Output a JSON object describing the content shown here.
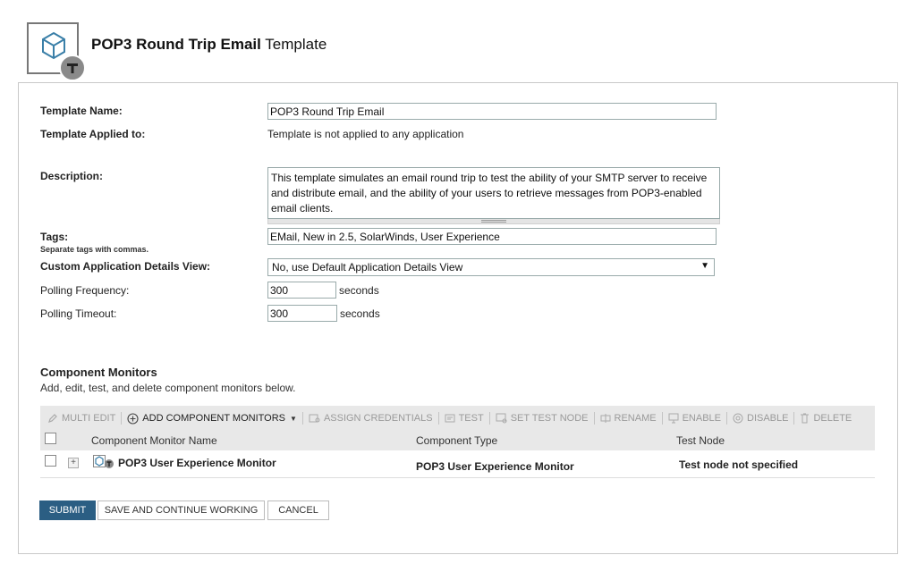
{
  "header": {
    "title_bold": "POP3 Round Trip Email",
    "title_rest": "Template",
    "icon": "template-cube-icon"
  },
  "form": {
    "name_label": "Template Name:",
    "name_value": "POP3 Round Trip Email",
    "applied_label": "Template Applied to:",
    "applied_value": "Template is not applied to any application",
    "desc_label": "Description:",
    "desc_value": "This template simulates an email round trip to test the ability of your SMTP server to receive and distribute email, and the ability of your users to retrieve messages from POP3-enabled email clients.",
    "tags_label": "Tags:",
    "tags_hint": "Separate tags with commas.",
    "tags_value": "EMail, New in 2.5, SolarWinds, User Experience",
    "view_label": "Custom Application Details View:",
    "view_value": "No, use Default Application Details View",
    "poll_freq_label": "Polling Frequency:",
    "poll_freq_value": "300",
    "poll_freq_unit": "seconds",
    "poll_timeout_label": "Polling Timeout:",
    "poll_timeout_value": "300",
    "poll_timeout_unit": "seconds"
  },
  "components": {
    "title": "Component Monitors",
    "description": "Add, edit, test, and delete component monitors below.",
    "toolbar": {
      "multi_edit": "Multi Edit",
      "add": "Add Component Monitors",
      "assign": "Assign Credentials",
      "test": "Test",
      "set_test_node": "Set Test Node",
      "rename": "Rename",
      "enable": "Enable",
      "disable": "Disable",
      "delete": "Delete"
    },
    "columns": {
      "name": "Component Monitor Name",
      "type": "Component Type",
      "node": "Test Node"
    },
    "rows": [
      {
        "name": "POP3 User Experience Monitor",
        "type": "POP3 User Experience Monitor",
        "node": "Test node not specified"
      }
    ]
  },
  "actions": {
    "submit": "Submit",
    "save_continue": "Save and Continue Working",
    "cancel": "Cancel"
  },
  "colors": {
    "primary": "#2b5e83",
    "toolbar_bg": "#e8e8e8",
    "accent_icon": "#3a7fa8"
  }
}
